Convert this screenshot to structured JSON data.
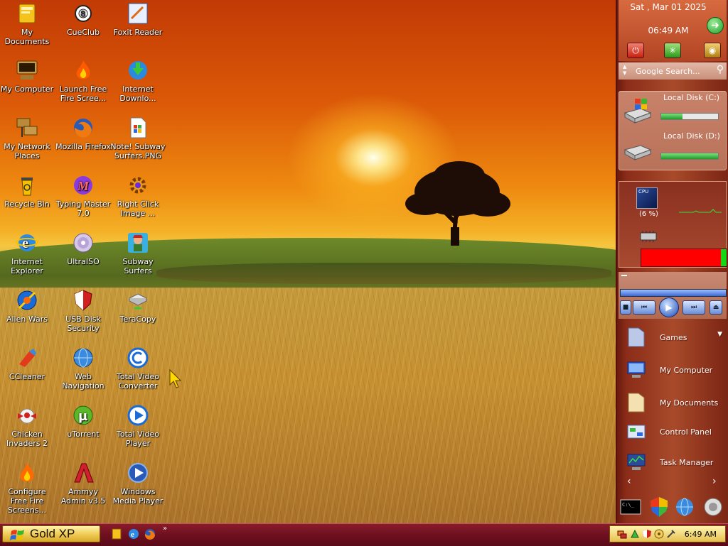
{
  "desktop": {
    "icons": [
      {
        "label": "My Documents",
        "icon": "folder-documents-icon"
      },
      {
        "label": "My Computer",
        "icon": "computer-icon"
      },
      {
        "label": "My Network Places",
        "icon": "network-places-icon"
      },
      {
        "label": "Recycle Bin",
        "icon": "recycle-bin-icon"
      },
      {
        "label": "Internet Explorer",
        "icon": "internet-explorer-icon"
      },
      {
        "label": "Alien Wars",
        "icon": "alien-wars-icon"
      },
      {
        "label": "CCleaner",
        "icon": "ccleaner-icon"
      },
      {
        "label": "Chicken Invaders 2",
        "icon": "chicken-invaders-icon"
      },
      {
        "label": "Configure Free Fire Screens...",
        "icon": "fire-screensaver-icon"
      },
      {
        "label": "CueClub",
        "icon": "cueclub-icon"
      },
      {
        "label": "Launch Free Fire Scree...",
        "icon": "fire-icon"
      },
      {
        "label": "Mozilla Firefox",
        "icon": "firefox-icon"
      },
      {
        "label": "Typing Master 7.0",
        "icon": "typing-master-icon"
      },
      {
        "label": "UltraISO",
        "icon": "disc-icon"
      },
      {
        "label": "USB Disk Security",
        "icon": "shield-icon"
      },
      {
        "label": "Web Navigation",
        "icon": "globe-icon"
      },
      {
        "label": "uTorrent",
        "icon": "utorrent-icon"
      },
      {
        "label": "Ammyy Admin v3.5",
        "icon": "ammyy-admin-icon"
      },
      {
        "label": "Foxit Reader",
        "icon": "pdf-reader-icon"
      },
      {
        "label": "Internet Downlo...",
        "icon": "download-manager-icon"
      },
      {
        "label": "Note! Subway Surfers.PNG",
        "icon": "image-file-icon"
      },
      {
        "label": "Right Click Image ...",
        "icon": "gear-icon"
      },
      {
        "label": "Subway Surfers",
        "icon": "subway-surfers-icon"
      },
      {
        "label": "TeraCopy",
        "icon": "teracopy-icon"
      },
      {
        "label": "Total Video Converter",
        "icon": "video-converter-icon"
      },
      {
        "label": "Total Video Player",
        "icon": "video-player-icon"
      },
      {
        "label": "Windows Media Player",
        "icon": "media-player-icon"
      }
    ]
  },
  "sidebar": {
    "date": "Sat , Mar 01 2025",
    "time": "06:49 AM",
    "search_placeholder": "Google Search...",
    "disks": [
      {
        "label": "Local Disk (C:)",
        "used": 0.38
      },
      {
        "label": "Local Disk (D:)",
        "used": 1.0
      }
    ],
    "cpu_label": "CPU",
    "cpu_percent_text": "(6 %)",
    "ram_used": 0.93,
    "launcher": [
      {
        "label": "Games",
        "icon": "games-folder-icon"
      },
      {
        "label": "My Computer",
        "icon": "computer-icon"
      },
      {
        "label": "My Documents",
        "icon": "folder-documents-icon"
      },
      {
        "label": "Control Panel",
        "icon": "control-panel-icon"
      },
      {
        "label": "Task Manager",
        "icon": "task-manager-icon"
      }
    ]
  },
  "taskbar": {
    "start_label": "Gold XP",
    "quick_more": "»",
    "clock": "6:49 AM"
  },
  "colors": {
    "taskbar": "#6e1020",
    "start_button": "#f2d060",
    "ram_bar": "#ff0000"
  }
}
